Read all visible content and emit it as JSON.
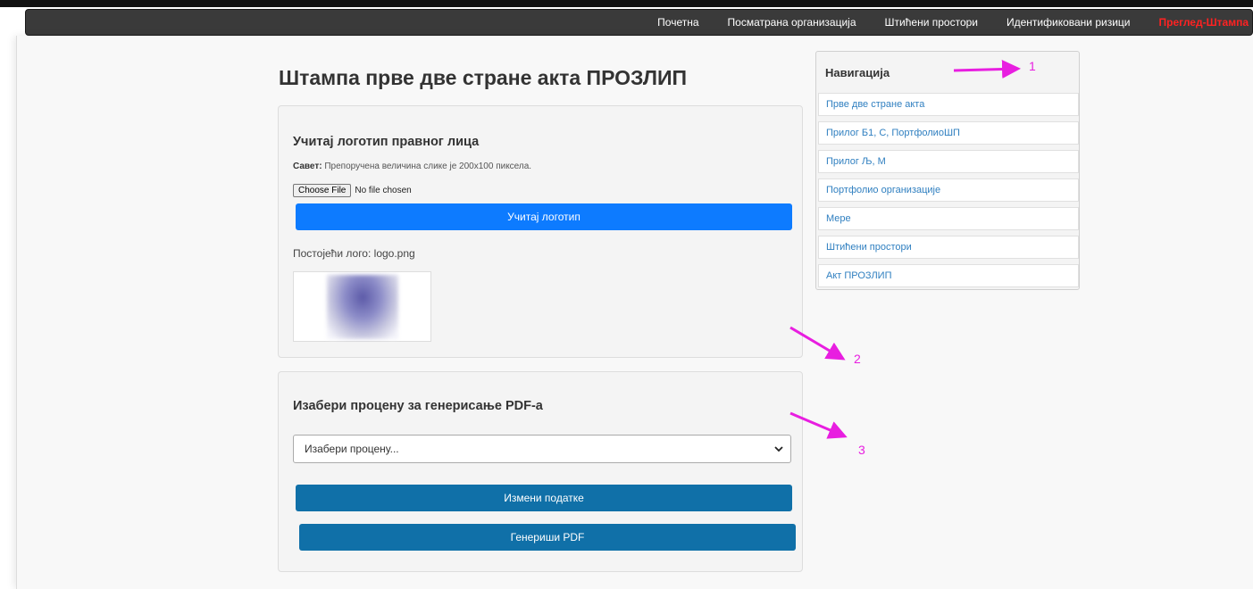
{
  "topnav": {
    "items": [
      "Почетна",
      "Посматрана организација",
      "Штићени простори",
      "Идентификовани ризици"
    ],
    "active": "Преглед-Штампа"
  },
  "page": {
    "title": "Штампа прве две стране акта ПРОЗЛИП"
  },
  "upload_card": {
    "heading": "Учитај логотип правног лица",
    "tip_label": "Савет:",
    "tip_text": "Препоручена величина слике је 200x100 пиксела.",
    "choose_file": "Choose File",
    "no_file": "No file chosen",
    "upload_button": "Учитај логотип",
    "existing_logo": "Постојећи лого: logo.png"
  },
  "assessment_card": {
    "heading": "Изабери процену за генерисање PDF-а",
    "select_value": "Изабери процену...",
    "edit_button": "Измени податке",
    "pdf_button": "Генериши PDF"
  },
  "sidebar": {
    "title": "Навигација",
    "items": [
      "Прве две стране акта",
      "Прилог Б1, С, ПортфолиоШП",
      "Прилог Љ, М",
      "Портфолио организације",
      "Мере",
      "Штићени простори",
      "Акт ПРОЗЛИП"
    ]
  },
  "annotations": [
    "1",
    "2",
    "3"
  ],
  "colors": {
    "accent_pink": "#e81ee0",
    "primary_blue": "#0d7bff",
    "dark_blue": "#1070a8",
    "active_nav": "#ff2222"
  }
}
